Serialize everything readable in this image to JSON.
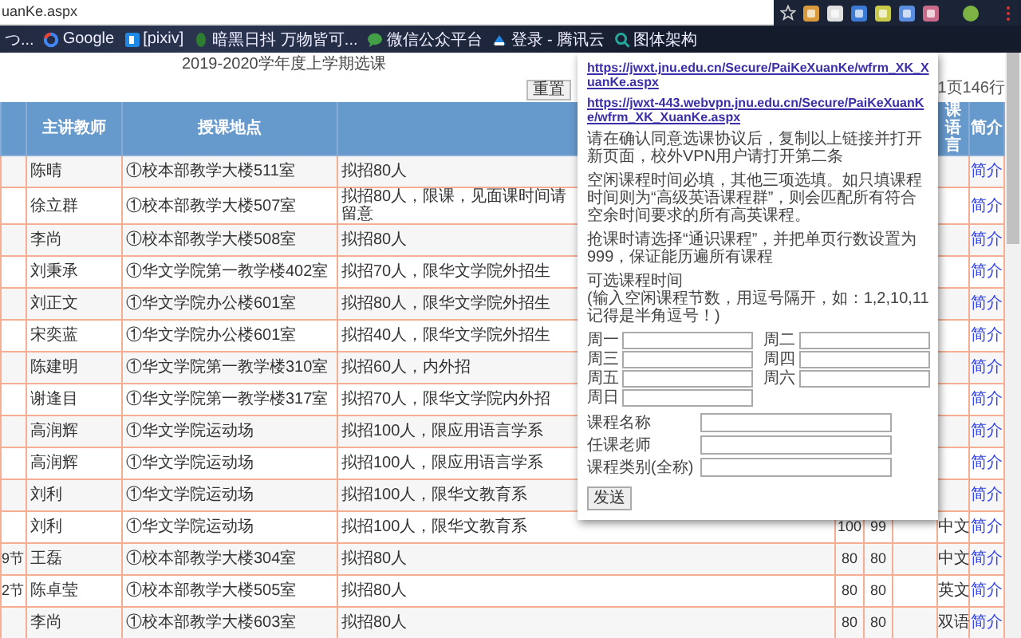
{
  "browser": {
    "address": "uanKe.aspx",
    "bookmarks": [
      {
        "label": "つ..."
      },
      {
        "label": "Google"
      },
      {
        "label": "[pixiv]"
      },
      {
        "label": "暗黑日抖 万物皆可..."
      },
      {
        "label": "微信公众平台"
      },
      {
        "label": "登录 - 腾讯云"
      },
      {
        "label": "图体架构"
      }
    ]
  },
  "page": {
    "title": "2019-2020学年度上学期选课",
    "reset_button": "重置",
    "page_info": "1页146行"
  },
  "table": {
    "columns": {
      "teacher": "主讲教师",
      "location": "授课地点",
      "language": "课语言",
      "intro": "简介"
    },
    "rows": [
      {
        "teacher": "陈晴",
        "location": "①校本部教学大楼511室",
        "note": "拟招80人",
        "intro": "简介"
      },
      {
        "teacher": "徐立群",
        "location": "①校本部教学大楼507室",
        "note": "拟招80人，限课，见面课时间请留意",
        "intro": "简介"
      },
      {
        "teacher": "李尚",
        "location": "①校本部教学大楼508室",
        "note": "拟招80人",
        "intro": "简介"
      },
      {
        "teacher": "刘秉承",
        "location": "①华文学院第一教学楼402室",
        "note": "拟招70人，限华文学院外招生",
        "intro": "简介"
      },
      {
        "teacher": "刘正文",
        "location": "①华文学院办公楼601室",
        "note": "拟招80人，限华文学院外招生",
        "intro": "简介"
      },
      {
        "teacher": "宋奕蓝",
        "location": "①华文学院办公楼601室",
        "note": "拟招40人，限华文学院外招生",
        "intro": "简介"
      },
      {
        "teacher": "陈建明",
        "location": "①华文学院第一教学楼310室",
        "note": "拟招60人，内外招",
        "intro": "简介"
      },
      {
        "teacher": "谢逢目",
        "location": "①华文学院第一教学楼317室",
        "note": "拟招70人，限华文学院内外招",
        "intro": "简介"
      },
      {
        "teacher": "高润辉",
        "location": "①华文学院运动场",
        "note": "拟招100人，限应用语言学系",
        "intro": "简介"
      },
      {
        "teacher": "高润辉",
        "location": "①华文学院运动场",
        "note": "拟招100人，限应用语言学系",
        "intro": "简介"
      },
      {
        "teacher": "刘利",
        "location": "①华文学院运动场",
        "note": "拟招100人，限华文教育系",
        "intro": "简介"
      },
      {
        "teacher": "刘利",
        "location": "①华文学院运动场",
        "note": "拟招100人，限华文教育系",
        "column_5": "100",
        "column_6": "99",
        "language": "中文",
        "intro": "简介"
      },
      {
        "column_1": "9节",
        "teacher": "王磊",
        "location": "①校本部教学大楼304室",
        "note": "拟招80人",
        "column_5": "80",
        "column_6": "80",
        "language": "中文",
        "intro": "简介"
      },
      {
        "column_1": "2节",
        "teacher": "陈卓莹",
        "location": "①校本部教学大楼505室",
        "note": "拟招80人",
        "column_5": "80",
        "column_6": "80",
        "language": "英文",
        "intro": "简介"
      },
      {
        "teacher": "李尚",
        "location": "①校本部教学大楼603室",
        "note": "拟招80人",
        "column_5": "80",
        "column_6": "80",
        "language": "双语",
        "intro": "简介"
      }
    ]
  },
  "popup": {
    "links": [
      "https://jwxt.jnu.edu.cn/Secure/PaiKeXuanKe/wfrm_XK_XuanKe.aspx",
      "https://jwxt-443.webvpn.jnu.edu.cn/Secure/PaiKeXuanKe/wfrm_XK_XuanKe.aspx"
    ],
    "paragraphs": [
      "请在确认同意选课协议后，复制以上链接并打开新页面，校外VPN用户请打开第二条",
      "空闲课程时间必填，其他三项选填。如只填课程时间则为“高级英语课程群”，则会匹配所有符合空余时间要求的所有高英课程。",
      "抢课时请选择“通识课程”，并把单页行数设置为999，保证能历遍所有课程"
    ],
    "time_title": "可选课程时间",
    "time_hint": "(输入空闲课程节数，用逗号隔开，如：1,2,10,11 记得是半角逗号！)",
    "days": [
      "周一",
      "周二",
      "周三",
      "周四",
      "周五",
      "周六",
      "周日"
    ],
    "fields": [
      {
        "label": "课程名称"
      },
      {
        "label": "任课老师"
      },
      {
        "label": "课程类别(全称)"
      }
    ],
    "submit": "发送"
  }
}
